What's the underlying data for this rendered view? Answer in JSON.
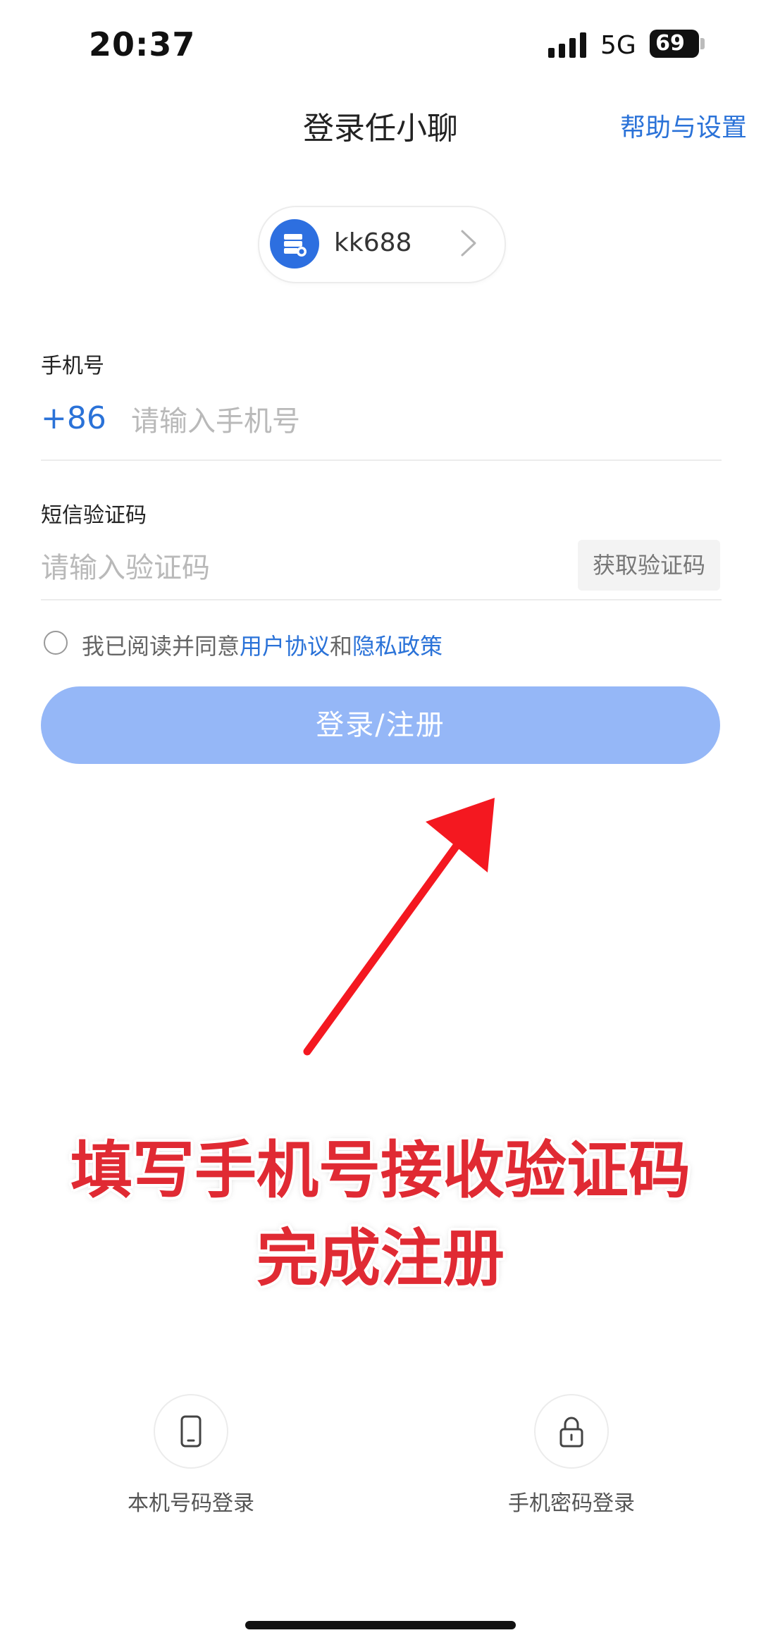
{
  "status_bar": {
    "time": "20:37",
    "network": "5G",
    "battery": "69"
  },
  "header": {
    "title": "登录任小聊",
    "help_link": "帮助与设置"
  },
  "server": {
    "name": "kk688"
  },
  "form": {
    "phone_label": "手机号",
    "country_code": "+86",
    "phone_placeholder": "请输入手机号",
    "code_label": "短信验证码",
    "code_placeholder": "请输入验证码",
    "get_code_button": "获取验证码"
  },
  "agreement": {
    "prefix": "我已阅读并同意",
    "user_agreement": "用户协议",
    "and": "和",
    "privacy_policy": "隐私政策"
  },
  "login_button": "登录/注册",
  "annotation": {
    "line1": "填写手机号接收验证码",
    "line2": "完成注册"
  },
  "alt_login": {
    "local_number": "本机号码登录",
    "phone_password": "手机密码登录"
  },
  "colors": {
    "accent": "#2a72d8",
    "button_disabled": "#95b7f7",
    "annotation_red": "#e02a33"
  },
  "icons": [
    "cellular-signal-icon",
    "battery-icon",
    "server-icon",
    "chevron-right-icon",
    "phone-icon",
    "lock-icon",
    "arrow-annotation"
  ]
}
